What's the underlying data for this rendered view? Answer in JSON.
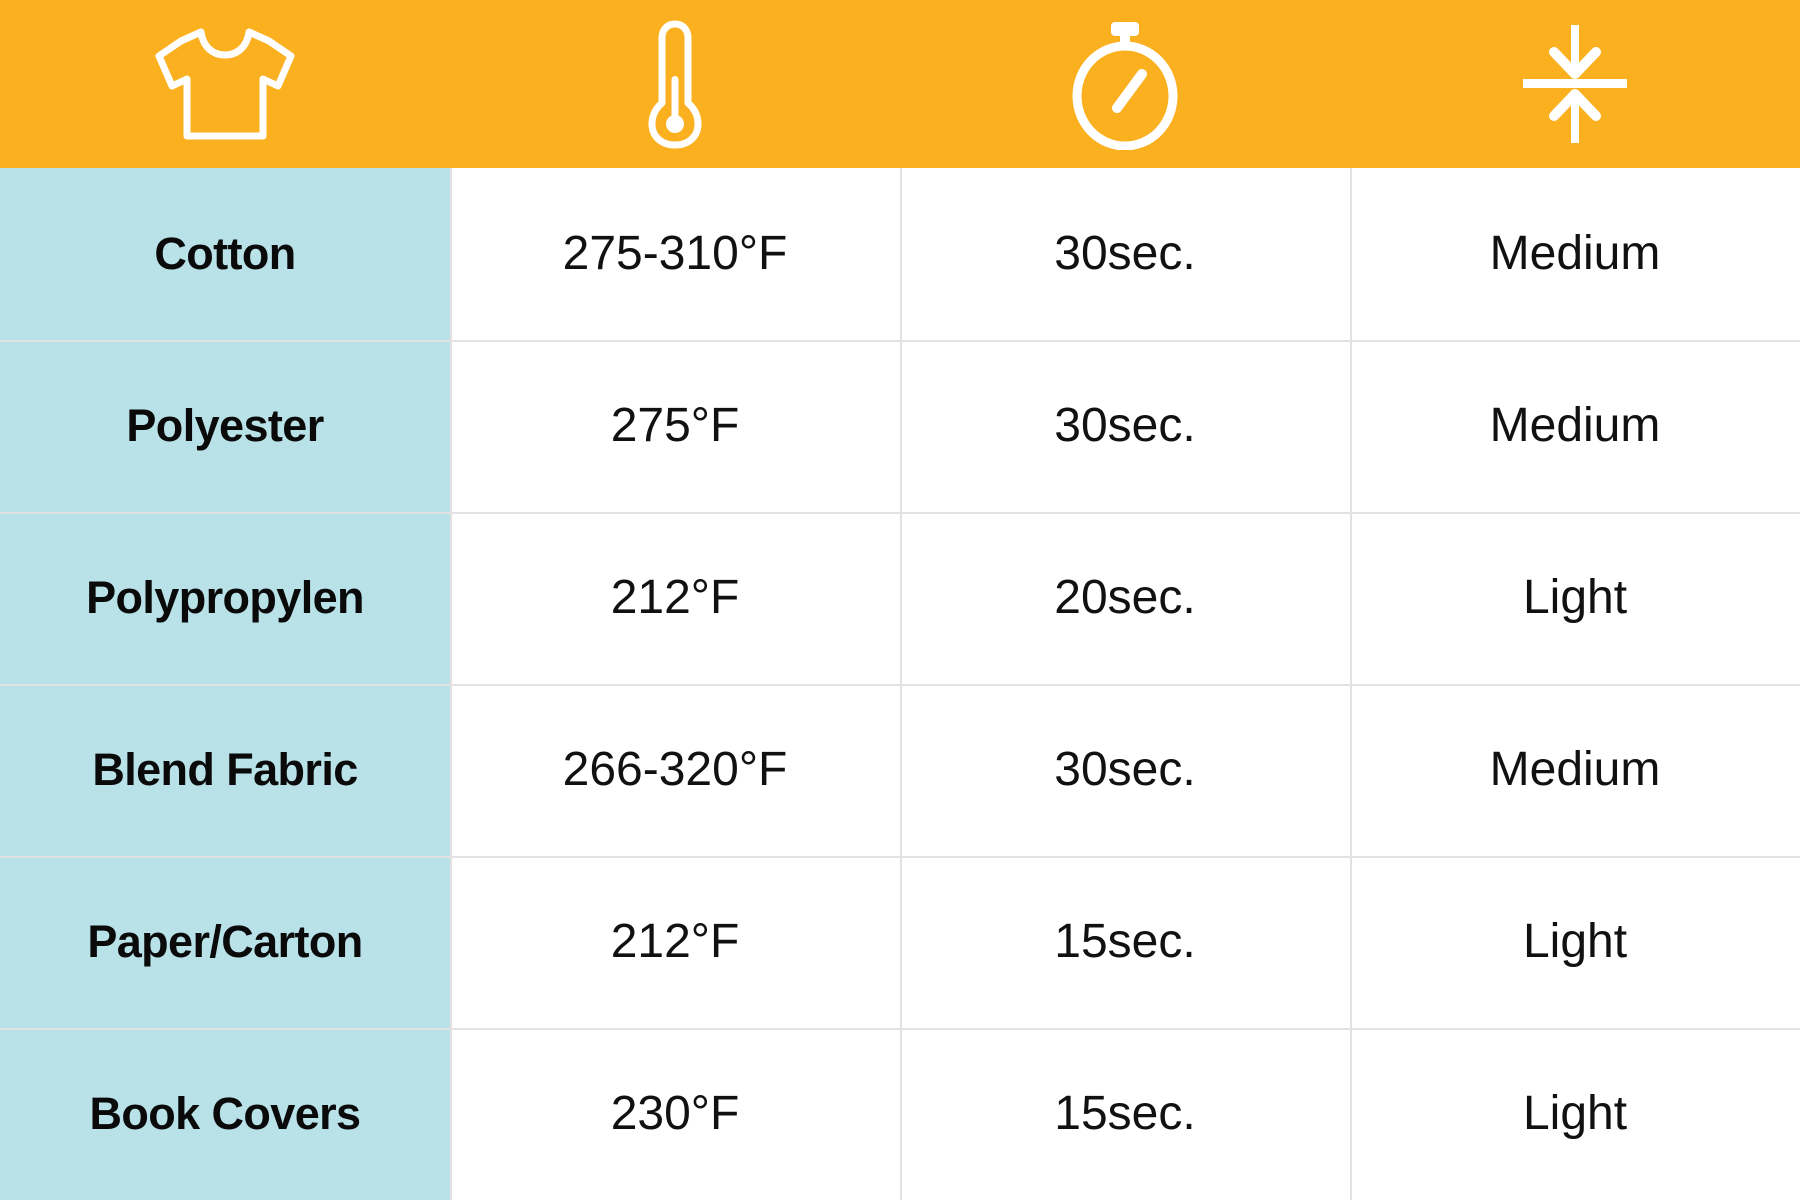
{
  "theme": {
    "header_background": "#FBB01F",
    "material_column_background": "#B8E1E8",
    "cell_background": "#FFFFFF",
    "grid_line": "#E2E2E2",
    "text_color": "#0A0A0A",
    "icon_color": "#FFFFFF"
  },
  "table": {
    "columns": [
      {
        "key": "material",
        "icon": "tshirt-icon",
        "header_label": ""
      },
      {
        "key": "temperature",
        "icon": "thermometer-icon",
        "header_label": ""
      },
      {
        "key": "time",
        "icon": "stopwatch-icon",
        "header_label": ""
      },
      {
        "key": "pressure",
        "icon": "pressure-arrows-icon",
        "header_label": ""
      }
    ],
    "rows": [
      {
        "material": "Cotton",
        "temperature": "275-310°F",
        "time": "30sec.",
        "pressure": "Medium"
      },
      {
        "material": "Polyester",
        "temperature": "275°F",
        "time": "30sec.",
        "pressure": "Medium"
      },
      {
        "material": "Polypropylen",
        "temperature": "212°F",
        "time": "20sec.",
        "pressure": "Light"
      },
      {
        "material": "Blend Fabric",
        "temperature": "266-320°F",
        "time": "30sec.",
        "pressure": "Medium"
      },
      {
        "material": "Paper/Carton",
        "temperature": "212°F",
        "time": "15sec.",
        "pressure": "Light"
      },
      {
        "material": "Book Covers",
        "temperature": "230°F",
        "time": "15sec.",
        "pressure": "Light"
      }
    ]
  }
}
